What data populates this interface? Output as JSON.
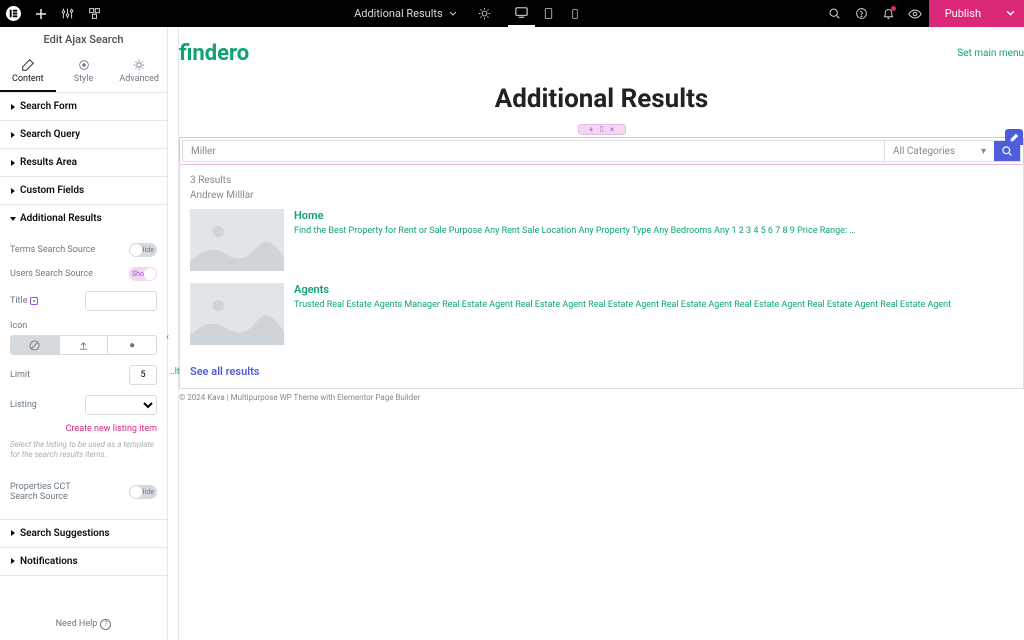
{
  "topbar": {
    "doc_title": "Additional Results",
    "publish": "Publish"
  },
  "sidebar": {
    "title": "Edit Ajax Search",
    "tabs": {
      "content": "Content",
      "style": "Style",
      "advanced": "Advanced"
    },
    "sections": {
      "search_form": "Search Form",
      "search_query": "Search Query",
      "results_area": "Results Area",
      "custom_fields": "Custom Fields",
      "additional_results": "Additional Results",
      "search_suggestions": "Search Suggestions",
      "notifications": "Notifications"
    },
    "controls": {
      "terms_source": "Terms Search Source",
      "terms_toggle": "Hide",
      "users_source": "Users Search Source",
      "users_toggle": "Show",
      "title": "Title",
      "title_value": "",
      "icon": "Icon",
      "limit": "Limit",
      "limit_value": "5",
      "listing": "Listing",
      "create_listing": "Create new listing item",
      "hint": "Select the listing to be used as a template for the search results items.",
      "props_cct": "Properties CCT Search Source",
      "props_toggle": "Hide"
    },
    "need_help": "Need Help"
  },
  "page": {
    "brand": "findero",
    "mainmenu": "Set main menu",
    "title": "Additional Results",
    "search_value": "Miller",
    "cat_label": "All Categories",
    "results_count": "3 Results",
    "sub": "Andrew Milllar",
    "items": [
      {
        "title": "Home",
        "desc": "Find the Best Property for Rent or Sale Purpose Any Rent Sale Location Any Property Type Any Bedrooms Any 1 2 3 4 5 6 7 8 9 Price Range: …"
      },
      {
        "title": "Agents",
        "desc": "Trusted Real Estate Agents Manager Real Estate Agent Real Estate Agent Real Estate Agent Real Estate Agent Real Estate Agent Real Estate Agent Real Estate Agent"
      }
    ],
    "see_all": "See all results",
    "credit": "© 2024 Kava | Multipurpose WP Theme with Elementor Page Builder"
  }
}
